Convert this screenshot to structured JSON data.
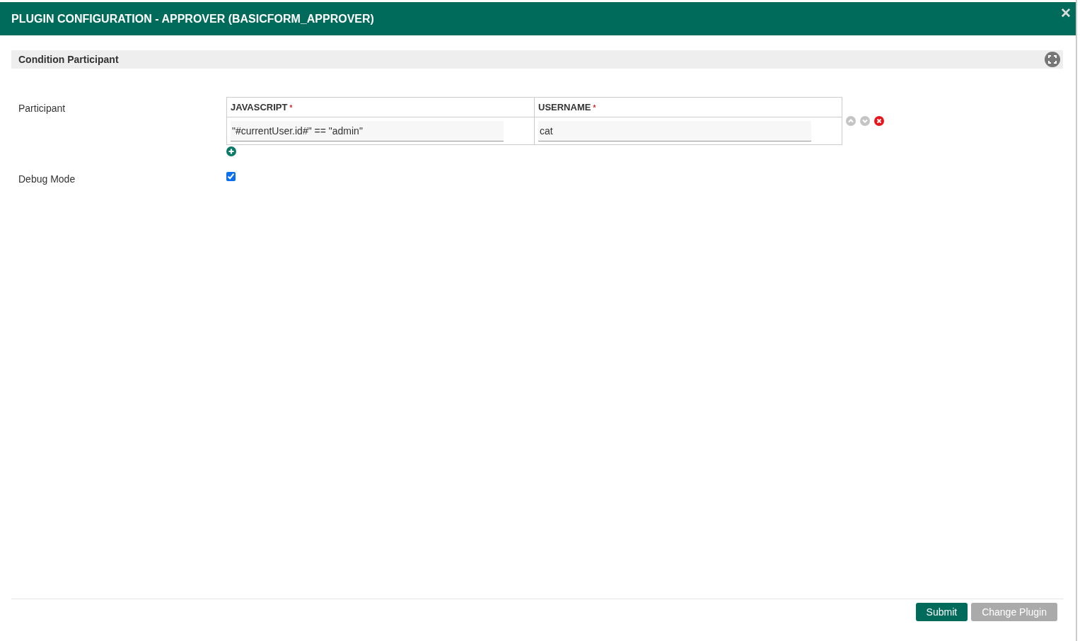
{
  "dialog": {
    "title": "PLUGIN CONFIGURATION - APPROVER (BASICFORM_APPROVER)",
    "close_icon": "✕"
  },
  "section": {
    "title": "Condition Participant"
  },
  "participant": {
    "label": "Participant",
    "columns": [
      {
        "label": "JAVASCRIPT",
        "required_mark": "*"
      },
      {
        "label": "USERNAME",
        "required_mark": "*"
      }
    ],
    "rows": [
      {
        "values": [
          "\"#currentUser.id#\" == \"admin\"",
          "cat"
        ]
      }
    ]
  },
  "debug_mode": {
    "label": "Debug Mode",
    "checked": true
  },
  "buttons": [
    {
      "label": "Submit",
      "kind": "primary"
    },
    {
      "label": "Change Plugin",
      "kind": "secondary"
    }
  ]
}
